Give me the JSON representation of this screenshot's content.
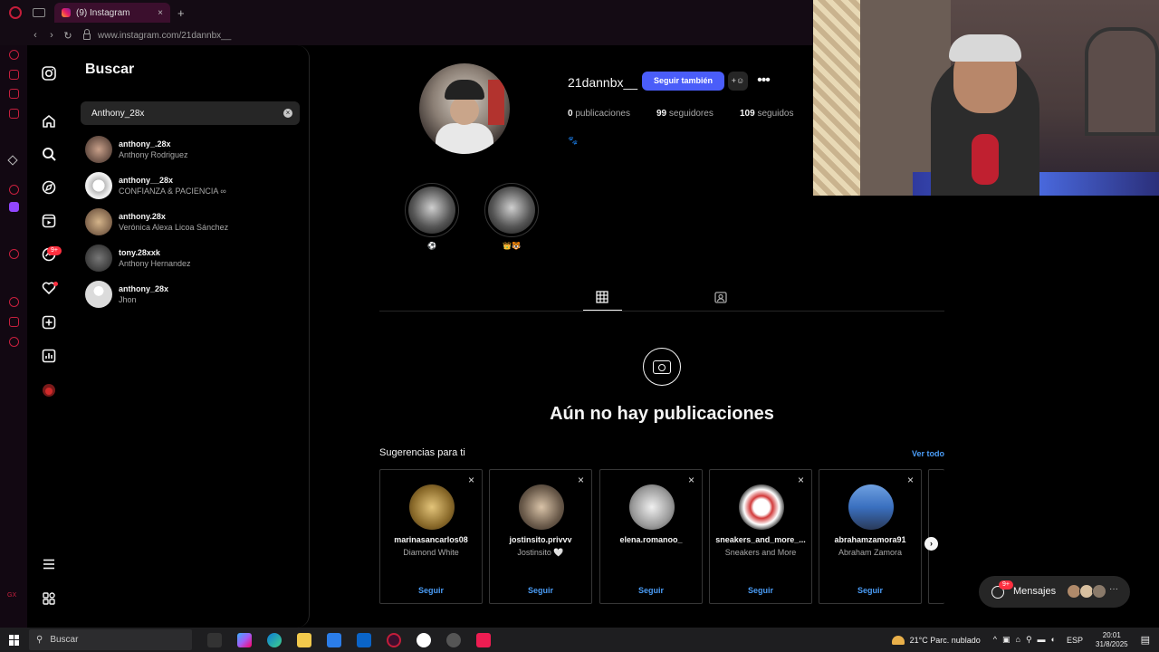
{
  "browser": {
    "tab_title": "(9) Instagram",
    "tab_close": "×",
    "new_tab": "+",
    "url": "www.instagram.com/21dannbx__"
  },
  "search_panel": {
    "title": "Buscar",
    "query": "Anthony_28x",
    "clear": "×",
    "results": [
      {
        "username": "anthony_.28x",
        "name": "Anthony Rodriguez"
      },
      {
        "username": "anthony__28x",
        "name": "CONFIANZA & PACIENCIA ∞"
      },
      {
        "username": "anthony.28x",
        "name": "Verónica Alexa Licoa Sánchez"
      },
      {
        "username": "tony.28xxk",
        "name": "Anthony Hernandez"
      },
      {
        "username": "anthony_28x",
        "name": "Jhon"
      }
    ]
  },
  "profile": {
    "username": "21dannbx__",
    "follow_button": "Seguir también",
    "posts_count": "0",
    "posts_label": "publicaciones",
    "followers_count": "99",
    "followers_label": "seguidores",
    "following_count": "109",
    "following_label": "seguidos",
    "bio": "🐾",
    "highlights": [
      {
        "label": "⚽"
      },
      {
        "label": "👑🐯"
      }
    ]
  },
  "empty_state": {
    "title": "Aún no hay publicaciones"
  },
  "suggestions": {
    "title": "Sugerencias para ti",
    "see_all": "Ver todo",
    "follow_label": "Seguir",
    "cards": [
      {
        "username": "marinasancarlos08",
        "name": "Diamond White"
      },
      {
        "username": "jostinsito.privvv",
        "name": "Jostinsito 🤍"
      },
      {
        "username": "elena.romanoo_",
        "name": ""
      },
      {
        "username": "sneakers_and_more_...",
        "name": "Sneakers and More"
      },
      {
        "username": "abrahamzamora91",
        "name": "Abraham Zamora"
      }
    ]
  },
  "messages": {
    "label": "Mensajes",
    "badge": "9+",
    "more": "···"
  },
  "rail": {
    "notifications_badge": "9+"
  },
  "taskbar": {
    "search_label": "Buscar",
    "weather": "21°C  Parc. nublado",
    "language": "ESP",
    "time": "20:01",
    "date": "31/8/2025"
  },
  "colors": {
    "accent_blue": "#4a5df9",
    "link_blue": "#4a9cf6",
    "badge_red": "#ff3040",
    "opera_red": "#c7203e",
    "tab_bg": "#3b0f2d"
  }
}
